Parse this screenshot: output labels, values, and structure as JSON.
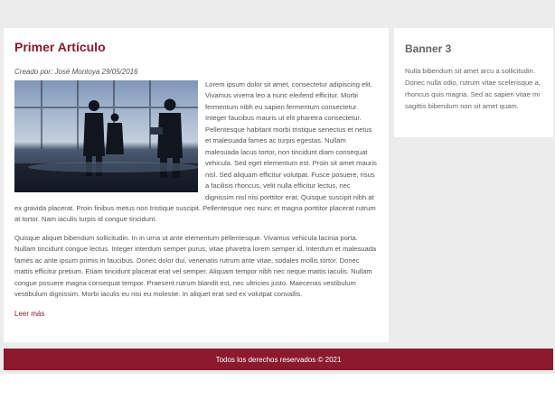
{
  "article": {
    "title": "Primer Artículo",
    "meta": "Creado por: José Montoya 29/05/2016",
    "photo_icon": "business-people-photo",
    "paragraph1": "Lorem ipsum dolor sit amet, consectetur adipiscing elit. Vivamus viverra leo a nunc eleifend efficitur. Morbi fermentum nibh eu sapien fermentum consectetur. Integer faucibus mauris ut elit pharetra consectetur. Pellentesque habitant morbi tristique senectus et netus et malesuada fames ac turpis egestas. Nullam malesuada lacus tortor, non tincidunt diam consequat vehicula. Sed eget elementum est. Proin sit amet mauris nisl. Sed aliquam efficitur volutpat. Fusce posuere, risus a facilisis rhoncus, velit nulla efficitur lectus, nec dignissim nisl nisi porttitor erat. Quisque suscipit nibh at ex gravida placerat. Proin finibus metus non tristique suscipit. Pellentesque nec nunc et magna porttitor placerat rutrum at tortor. Nam iaculis turpis id congue tincidunt.",
    "paragraph2": "Quisque aliquet bibendum sollicitudin. In in urna ut ante elementum pellentesque. Vivamus vehicula lacinia porta. Nullam tincidunt congue lectus. Integer interdum semper purus, vitae pharetra lorem semper id. Interdum et malesuada fames ac ante ipsum primis in faucibus. Donec dolor dui, venenatis rutrum ante vitae, sodales mollis tortor. Donec mattis efficitur pretium. Etiam tincidunt placerat erat vel semper. Aliquam tempor nibh nec neque mattis iaculis. Nullam congue posuere magna consequat tempor. Praesent rutrum blandit est, nec ultricies justo. Maecenas vestibulum vestibulum dignissim. Morbi iaculis eu nisi eu molestie. In aliquet erat sed ex volutpat convallis.",
    "read_more": "Leer más"
  },
  "banner": {
    "title": "Banner 3",
    "text": "Nulla bibendum sit amet arcu a sollicitudin. Donec nulla odio, rutrum vitae scelerisque a, rhoncus quis magna. Sed ac sapien vitae mi sagittis bibendum non sit amet quam."
  },
  "footer": {
    "text": "Todos los derechos reservados © 2021"
  },
  "colors": {
    "accent": "#8b1a2e",
    "background": "#ececec",
    "card": "#ffffff"
  }
}
